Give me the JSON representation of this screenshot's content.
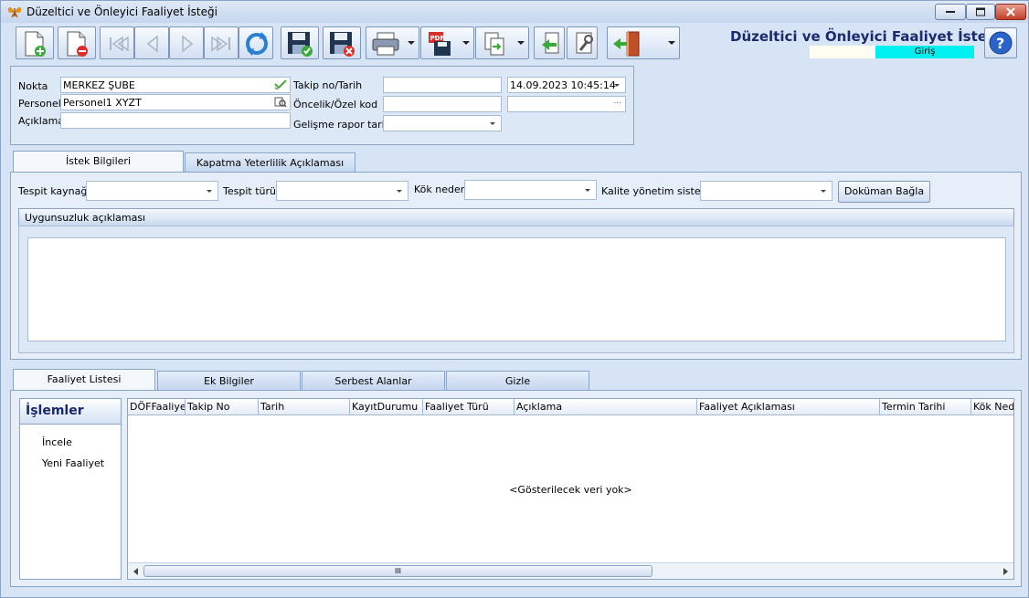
{
  "window": {
    "title": "Düzeltici ve Önleyici Faaliyet İsteği",
    "icon": "butterfly-icon"
  },
  "header": {
    "title": "Düzeltici ve Önleyici Faaliyet İsteği",
    "mode": "Giriş",
    "mode_color": "#00f0f0",
    "title_color": "#1a2a6c"
  },
  "toolbar": {
    "buttons": [
      "new-document-icon",
      "delete-document-icon",
      "first-record-icon",
      "previous-record-icon",
      "next-record-icon",
      "last-record-icon",
      "refresh-icon",
      "save-icon",
      "save-close-icon",
      "print-icon",
      "pdf-export-icon",
      "copy-icon",
      "back-icon",
      "settings-icon",
      "exit-icon",
      "help-icon"
    ]
  },
  "form": {
    "nokta_label": "Nokta",
    "nokta_value": "MERKEZ ŞUBE",
    "personel_label": "Personel",
    "personel_value": "Personel1 XYZT",
    "aciklama_label": "Açıklama",
    "aciklama_value": "",
    "takip_label": "Takip no/Tarih",
    "takip_value": "",
    "tarih_value": "14.09.2023 10:45:14",
    "oncelik_label": "Öncelik/Özel kod",
    "oncelik_value": "",
    "ozel_kod_value": "...",
    "gelisme_label": "Gelişme rapor tarihi",
    "gelisme_value": ""
  },
  "tabs_top": [
    {
      "label": "İstek Bilgileri"
    },
    {
      "label": "Kapatma Yeterlilik Açıklaması"
    }
  ],
  "istek": {
    "tespit_kaynagi_label": "Tespit kaynağı",
    "tespit_turu_label": "Tespit türü",
    "kok_neden_label": "Kök neden",
    "kalite_label": "Kalite yönetim sistemi",
    "dokuman_button": "Doküman Bağla",
    "uygunsuzluk_label": "Uygunsuzluk açıklaması"
  },
  "tabs_bottom": [
    {
      "label": "Faaliyet Listesi"
    },
    {
      "label": "Ek Bilgiler"
    },
    {
      "label": "Serbest Alanlar"
    },
    {
      "label": "Gizle"
    }
  ],
  "islemler": {
    "title": "İşlemler",
    "items": [
      "İncele",
      "Yeni Faaliyet"
    ]
  },
  "grid": {
    "columns": [
      "DÖFFaaliyet",
      "Takip No",
      "Tarih",
      "KayıtDurumu",
      "Faaliyet Türü",
      "Açıklama",
      "Faaliyet Açıklaması",
      "Termin Tarihi",
      "Kök Nede"
    ],
    "empty_text": "<Gösterilecek veri yok>",
    "scroll_grip": "III"
  }
}
